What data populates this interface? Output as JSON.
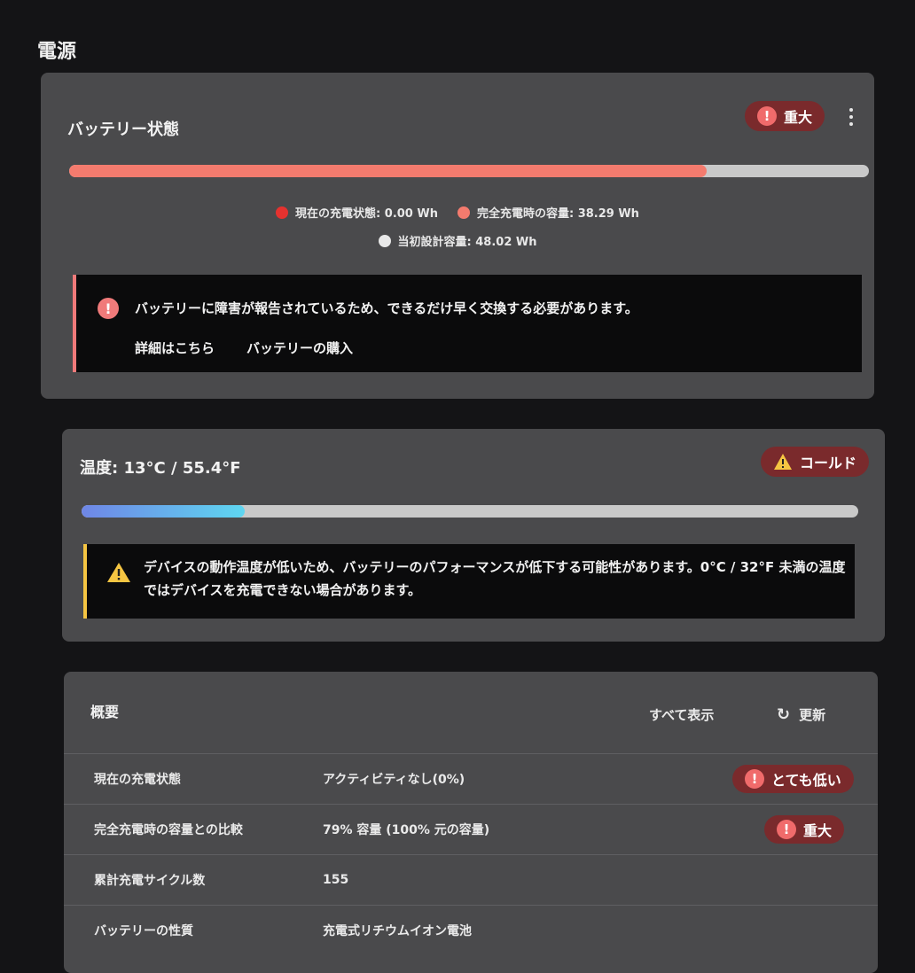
{
  "page": {
    "title": "電源"
  },
  "battery": {
    "title": "バッテリー状態",
    "badge": "重大",
    "bar": {
      "current_wh": 0.0,
      "full_wh": 38.29,
      "design_wh": 48.02,
      "full_fraction": 0.797
    },
    "legend": {
      "current": "現在の充電状態: 0.00 Wh",
      "full": "完全充電時の容量: 38.29 Wh",
      "design": "当初設計容量: 48.02 Wh"
    },
    "colors": {
      "current": "#e5322f",
      "full": "#f47b6e",
      "design": "#e8e8e8"
    },
    "alert": {
      "message": "バッテリーに障害が報告されているため、できるだけ早く交換する必要があります。",
      "link_details": "詳細はこちら",
      "link_buy": "バッテリーの購入"
    }
  },
  "temperature": {
    "title": "温度: 13°C / 55.4°F",
    "badge": "コールド",
    "bar": {
      "fraction": 0.21
    },
    "alert": {
      "line1": "デバイスの動作温度が低いため、バッテリーのパフォーマンスが低下する可能性があります。0°C / 32°F 未満の温度",
      "line2": "ではデバイスを充電できない場合があります。"
    }
  },
  "summary": {
    "title": "概要",
    "show_all": "すべて表示",
    "refresh": "更新",
    "rows": [
      {
        "label": "現在の充電状態",
        "value": "アクティビティなし(0%)",
        "badge": "とても低い"
      },
      {
        "label": "完全充電時の容量との比較",
        "value": "79% 容量 (100% 元の容量)",
        "badge": "重大"
      },
      {
        "label": "累計充電サイクル数",
        "value": "155",
        "badge": ""
      },
      {
        "label": "バッテリーの性質",
        "value": "充電式リチウムイオン電池",
        "badge": ""
      }
    ]
  }
}
